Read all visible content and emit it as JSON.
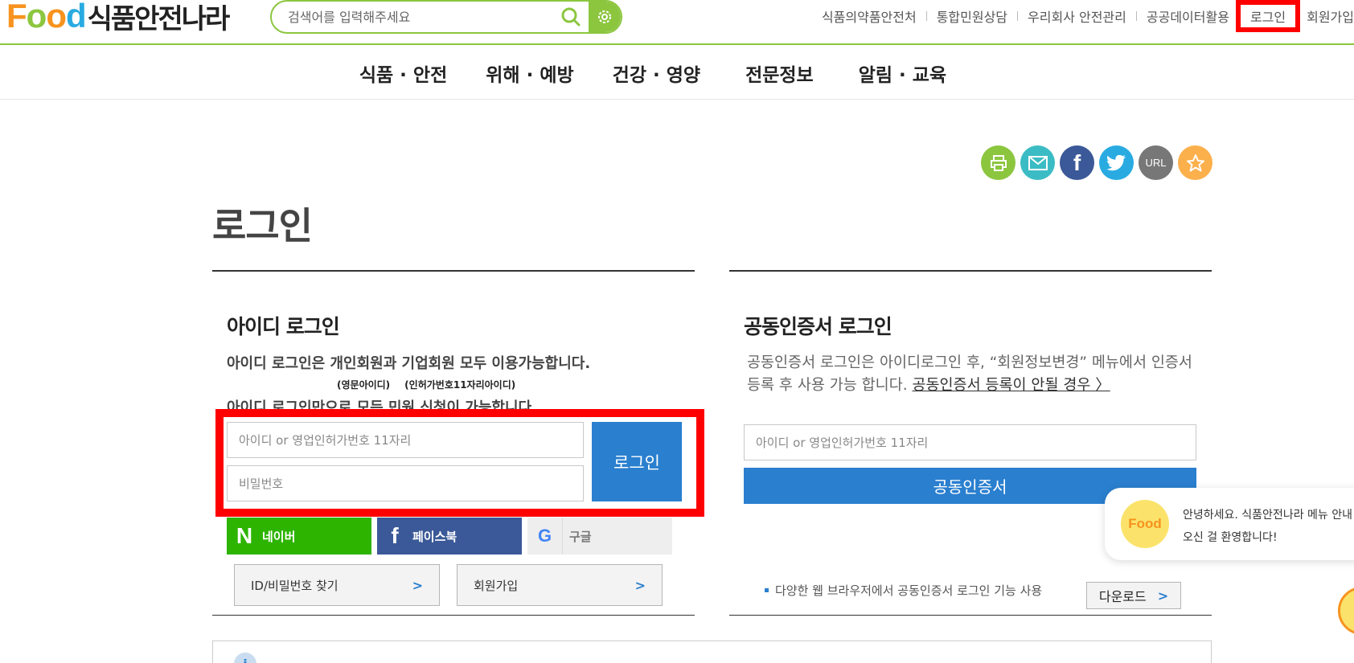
{
  "header": {
    "logo_food": "Food",
    "logo_kr": "식품안전나라",
    "search_placeholder": "검색어를 입력해주세요",
    "links": [
      "식품의약품안전처",
      "통합민원상담",
      "우리회사 안전관리",
      "공공데이터활용"
    ],
    "login": "로그인",
    "signup": "회원가입"
  },
  "gnb": [
    "식품 · 안전",
    "위해 · 예방",
    "건강 · 영양",
    "전문정보",
    "알림 · 교육"
  ],
  "share": {
    "url_label": "URL"
  },
  "page_title": "로그인",
  "id_login": {
    "heading": "아이디 로그인",
    "desc1": "아이디 로그인은 개인회원과 기업회원 모두 이용가능합니다.",
    "note_eng": "(영문아이디)",
    "note_license": "(인허가번호11자리아이디)",
    "desc2": "아이디 로그인만으로 모든 민원 신청이 가능합니다.",
    "id_placeholder": "아이디 or 영업인허가번호 11자리",
    "pw_placeholder": "비밀번호",
    "login_button": "로그인",
    "naver": "네이버",
    "facebook": "페이스북",
    "google": "구글",
    "find_id": "ID/비밀번호 찾기",
    "join": "회원가입"
  },
  "cert_login": {
    "heading": "공동인증서 로그인",
    "desc": "공동인증서 로그인은 아이디로그인 후, “회원정보변경” 메뉴에서 인증서 등록 후 사용 가능 합니다.",
    "desc_link": "공동인증서 등록이 안될 경우 〉",
    "id_placeholder": "아이디 or 영업인허가번호 11자리",
    "cert_button": "공동인증서",
    "browser_note": "다양한 웹 브라우저에서 공동인증서 로그인 기능 사용",
    "download": "다운로드"
  },
  "chatbot": {
    "avatar_label": "Food",
    "line1": "안녕하세요. 식품안전나라 메뉴 안내",
    "line2": "오신 걸 환영합니다!"
  },
  "colors": {
    "brand_green": "#8cc63f",
    "primary_blue": "#2a7fcf",
    "highlight_red": "#ff0000"
  }
}
